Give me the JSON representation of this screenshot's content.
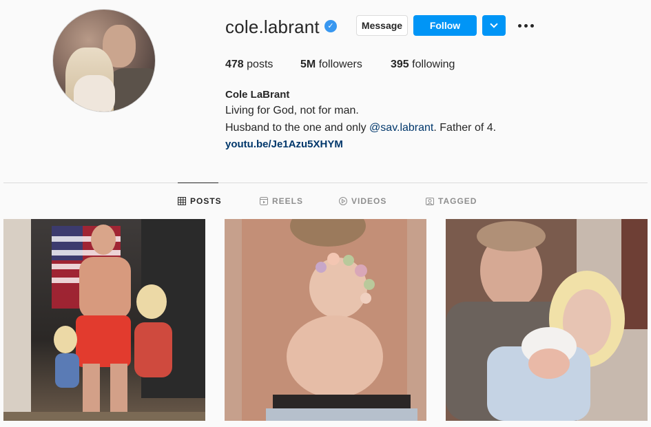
{
  "profile": {
    "username": "cole.labrant",
    "message_label": "Message",
    "follow_label": "Follow",
    "posts_count": "478",
    "posts_label": "posts",
    "followers_count": "5M",
    "followers_label": "followers",
    "following_count": "395",
    "following_label": "following",
    "full_name": "Cole LaBrant",
    "bio_line1": "Living for God, not for man.",
    "bio_line2_pre": "Husband to the one and only ",
    "bio_mention": "@sav.labrant",
    "bio_line2_post": ". Father of 4.",
    "link": "youtu.be/Je1Azu5XHYM"
  },
  "tabs": [
    {
      "label": "POSTS",
      "icon": "grid-icon",
      "active": true
    },
    {
      "label": "REELS",
      "icon": "reels-icon",
      "active": false
    },
    {
      "label": "VIDEOS",
      "icon": "play-icon",
      "active": false
    },
    {
      "label": "TAGGED",
      "icon": "tag-icon",
      "active": false
    }
  ],
  "colors": {
    "accent": "#0095f6",
    "verified": "#3897f0",
    "link": "#00376b"
  }
}
